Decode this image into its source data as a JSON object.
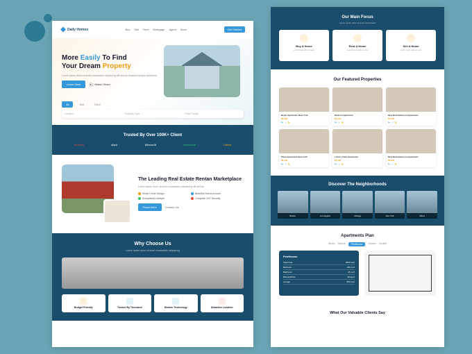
{
  "brand": "Daily Homes",
  "nav": {
    "items": [
      "Buy",
      "Sell",
      "Rent",
      "Mortgage",
      "Agent",
      "More"
    ],
    "cta": "Get Started"
  },
  "hero": {
    "title_1": "More",
    "title_hl1": "Easily",
    "title_2": "To Find",
    "title_3": "Your Dream",
    "title_hl2": "Property",
    "sub": "Lorem ipsum dolor sit amet consectetur adipiscing elit sed do eiusmod tempor incididunt",
    "btn": "Learn More",
    "watch": "Watch Video",
    "tabs": [
      "All",
      "Sell",
      "Rent"
    ],
    "search": [
      "Location",
      "Property Type",
      "Price Range"
    ]
  },
  "trusted": {
    "title": "Trusted By Over 100K+ Client",
    "logos": [
      "InVision",
      "slack",
      "Microsoft",
      "treehouse",
      "Lattice"
    ]
  },
  "leading": {
    "title": "The Leading Real Estate Rentan Marketplace",
    "sub": "Lorem ipsum dolor sit amet consectetur adipiscing elit sed do",
    "feats": [
      "Smart Home Design",
      "Beautiful Scene Around",
      "Exceptional Lifestyle",
      "Complete 24/7 Security"
    ],
    "btn1": "Read More",
    "btn2": "Contact Us"
  },
  "why": {
    "title": "Why Choose Us",
    "sub": "Lorem ipsum dolor sit amet consectetur adipiscing",
    "cards": [
      "Budget Friendly",
      "Trusted By Thousand",
      "Modern Technology",
      "Attractive Location"
    ]
  },
  "focus": {
    "title": "Our Main Focus",
    "sub": "Lorem ipsum dolor sit amet consectetur",
    "cards": [
      {
        "t": "Buy A Home",
        "d": "Lorem ipsum dolor sit amet"
      },
      {
        "t": "Rent A Home",
        "d": "Lorem ipsum dolor sit amet"
      },
      {
        "t": "Sell A Home",
        "d": "Lorem ipsum dolor sit amet"
      }
    ]
  },
  "props": {
    "title": "Our Featured Properties",
    "items": [
      {
        "t": "Bryan Apartment New York",
        "p": "$5,800"
      },
      {
        "t": "Modern Apartment",
        "p": "$3,200"
      },
      {
        "t": "New Built Bedroom Apartment",
        "p": "$4,500"
      },
      {
        "t": "Plaza Apartment New York",
        "p": "$6,100"
      },
      {
        "t": "Luxury Suite Downtown",
        "p": "$7,400"
      },
      {
        "t": "New Built Bedroom Apartment",
        "p": "$5,200"
      }
    ]
  },
  "neigh": {
    "title": "Discover The Neighborhoods",
    "items": [
      "Boston",
      "Los Angeles",
      "Chicago",
      "New York",
      "Miami"
    ]
  },
  "apt": {
    "title": "Apartments Plan",
    "tabs": [
      "Studio",
      "Deluxe",
      "Penthouse",
      "Garden",
      "Double"
    ],
    "panel_title": "Penthouse",
    "rows": [
      {
        "k": "Total Area",
        "v": "2800 sq ft"
      },
      {
        "k": "Bedroom",
        "v": "150 sq ft"
      },
      {
        "k": "Bathroom",
        "v": "45 sq ft"
      },
      {
        "k": "Belcony/Pets",
        "v": "Allowed"
      },
      {
        "k": "Lounge",
        "v": "650 sq ft"
      }
    ]
  },
  "testimonials": {
    "title": "What Our Valuable Clients Say"
  }
}
